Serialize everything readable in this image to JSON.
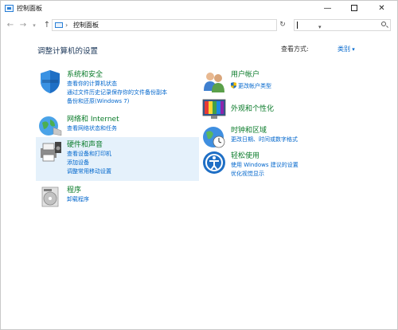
{
  "window": {
    "title": "控制面板"
  },
  "address": {
    "path": "控制面板",
    "separator": "›"
  },
  "search": {
    "placeholder": ""
  },
  "heading": "调整计算机的设置",
  "view": {
    "label": "查看方式:",
    "value": "类别"
  },
  "categories": {
    "system": {
      "title": "系统和安全",
      "links": [
        "查看你的计算机状态",
        "通过文件历史记录保存你的文件备份副本",
        "备份和还原(Windows 7)"
      ]
    },
    "network": {
      "title": "网络和 Internet",
      "links": [
        "查看网络状态和任务"
      ]
    },
    "hardware": {
      "title": "硬件和声音",
      "links": [
        "查看设备和打印机",
        "添加设备",
        "调整常用移动设置"
      ]
    },
    "programs": {
      "title": "程序",
      "links": [
        "卸载程序"
      ]
    },
    "users": {
      "title": "用户帐户",
      "links": [
        "更改帐户类型"
      ]
    },
    "appearance": {
      "title": "外观和个性化",
      "links": []
    },
    "clock": {
      "title": "时钟和区域",
      "links": [
        "更改日期、时间或数字格式"
      ]
    },
    "ease": {
      "title": "轻松使用",
      "links": [
        "使用 Windows 建议的设置",
        "优化视觉显示"
      ]
    }
  },
  "colors": {
    "category_title": "#0a7b2a",
    "link": "#0066cc",
    "hover_bg": "#e5f1fb"
  },
  "icons": [
    "shield-icon",
    "globe-network-icon",
    "printer-speaker-icon",
    "programs-disc-icon",
    "users-icon",
    "monitor-palette-icon",
    "clock-globe-icon",
    "ease-of-access-icon"
  ]
}
